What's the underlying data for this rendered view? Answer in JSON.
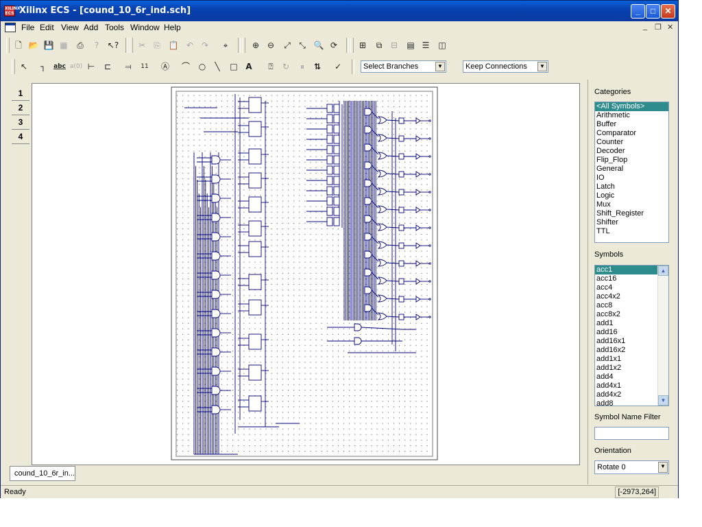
{
  "window": {
    "title": "Xilinx ECS - [cound_10_6r_ind.sch]",
    "app_icon_text": "XILINX ECS"
  },
  "menu": [
    "File",
    "Edit",
    "View",
    "Add",
    "Tools",
    "Window",
    "Help"
  ],
  "toolbar": {
    "select_branches": "Select Branches",
    "keep_connections": "Keep Connections"
  },
  "page_tabs": [
    "1",
    "2",
    "3",
    "4"
  ],
  "doc_tab": "cound_10_6r_in...",
  "panel": {
    "categories_label": "Categories",
    "categories": [
      "<All Symbols>",
      "Arithmetic",
      "Buffer",
      "Comparator",
      "Counter",
      "Decoder",
      "Flip_Flop",
      "General",
      "IO",
      "Latch",
      "Logic",
      "Mux",
      "Shift_Register",
      "Shifter",
      "TTL"
    ],
    "symbols_label": "Symbols",
    "symbols": [
      "acc1",
      "acc16",
      "acc4",
      "acc4x2",
      "acc8",
      "acc8x2",
      "add1",
      "add16",
      "add16x1",
      "add16x2",
      "add1x1",
      "add1x2",
      "add4",
      "add4x1",
      "add4x2",
      "add8"
    ],
    "filter_label": "Symbol Name Filter",
    "filter_value": "",
    "orientation_label": "Orientation",
    "orientation_value": "Rotate 0"
  },
  "status": {
    "text": "Ready",
    "coords": "[-2973,264]"
  },
  "colors": {
    "title_bar": "#0a46c0",
    "selection": "#2e8c8c",
    "schematic_wire": "#00007a"
  }
}
